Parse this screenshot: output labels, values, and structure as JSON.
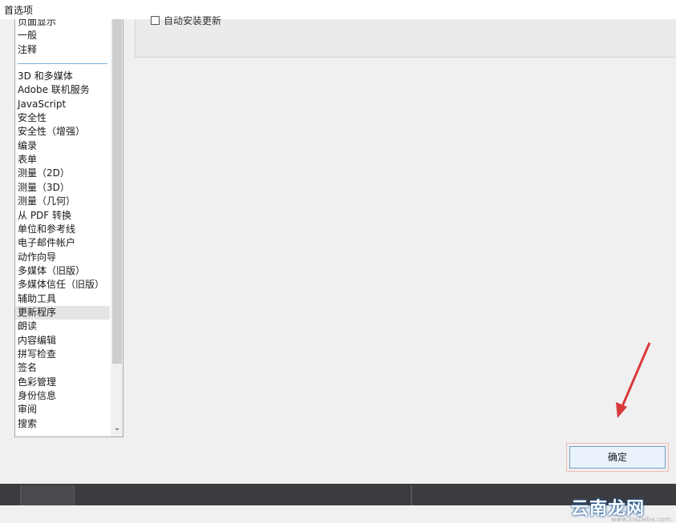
{
  "window": {
    "title": "首选项"
  },
  "categories": {
    "items": [
      {
        "label": "页面显示"
      },
      {
        "label": "一般"
      },
      {
        "label": "注释"
      },
      {
        "label": "3D 和多媒体"
      },
      {
        "label": "Adobe 联机服务"
      },
      {
        "label": "JavaScript"
      },
      {
        "label": "安全性"
      },
      {
        "label": "安全性（增强）"
      },
      {
        "label": "编录"
      },
      {
        "label": "表单"
      },
      {
        "label": "测量（2D）"
      },
      {
        "label": "测量（3D）"
      },
      {
        "label": "测量（几何）"
      },
      {
        "label": "从 PDF 转换"
      },
      {
        "label": "单位和参考线"
      },
      {
        "label": "电子邮件帐户"
      },
      {
        "label": "动作向导"
      },
      {
        "label": "多媒体（旧版）"
      },
      {
        "label": "多媒体信任（旧版）"
      },
      {
        "label": "辅助工具"
      },
      {
        "label": "更新程序"
      },
      {
        "label": "朗读"
      },
      {
        "label": "内容编辑"
      },
      {
        "label": "拼写检查"
      },
      {
        "label": "签名"
      },
      {
        "label": "色彩管理"
      },
      {
        "label": "身份信息"
      },
      {
        "label": "审阅"
      },
      {
        "label": "搜索"
      }
    ],
    "selected": "更新程序",
    "scroll_down_glyph": "⌄"
  },
  "content": {
    "checkbox_label": "自动安装更新",
    "checkbox_checked": false
  },
  "buttons": {
    "ok_label": "确定"
  },
  "watermark": {
    "brand": "云南龙网",
    "url": "www.xiazaiba.com"
  },
  "colors": {
    "annotation_arrow": "#d93a3a",
    "button_border": "#7a9cc6"
  }
}
